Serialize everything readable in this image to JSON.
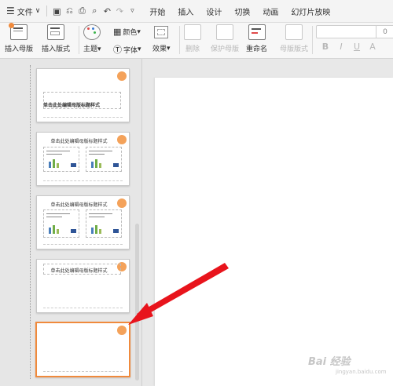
{
  "menubar": {
    "file_label": "文件",
    "tabs": [
      "开始",
      "插入",
      "设计",
      "切换",
      "动画",
      "幻灯片放映"
    ]
  },
  "ribbon": {
    "insert_master": "插入母版",
    "insert_layout": "插入版式",
    "theme": "主题",
    "color": "颜色",
    "font": "字体",
    "effect": "效果",
    "delete": "删除",
    "protect_master": "保护母版",
    "rename": "重命名",
    "master_layout": "母版版式",
    "font_size_value": "0",
    "format_buttons": [
      "B",
      "I",
      "U",
      "A"
    ]
  },
  "thumbnails": [
    {
      "title": "单击此处编辑母版标题样式"
    },
    {
      "title": "单击此处编辑母版标题样式"
    },
    {
      "title": "单击此处编辑母版标题样式"
    },
    {
      "title": "单击此处编辑母版标题样式"
    },
    {
      "title": ""
    }
  ],
  "watermark": {
    "text": "Bai 经验",
    "url": "jingyan.baidu.com"
  },
  "colors": {
    "accent_orange": "#f08a3c",
    "arrow_red": "#e8141c"
  }
}
